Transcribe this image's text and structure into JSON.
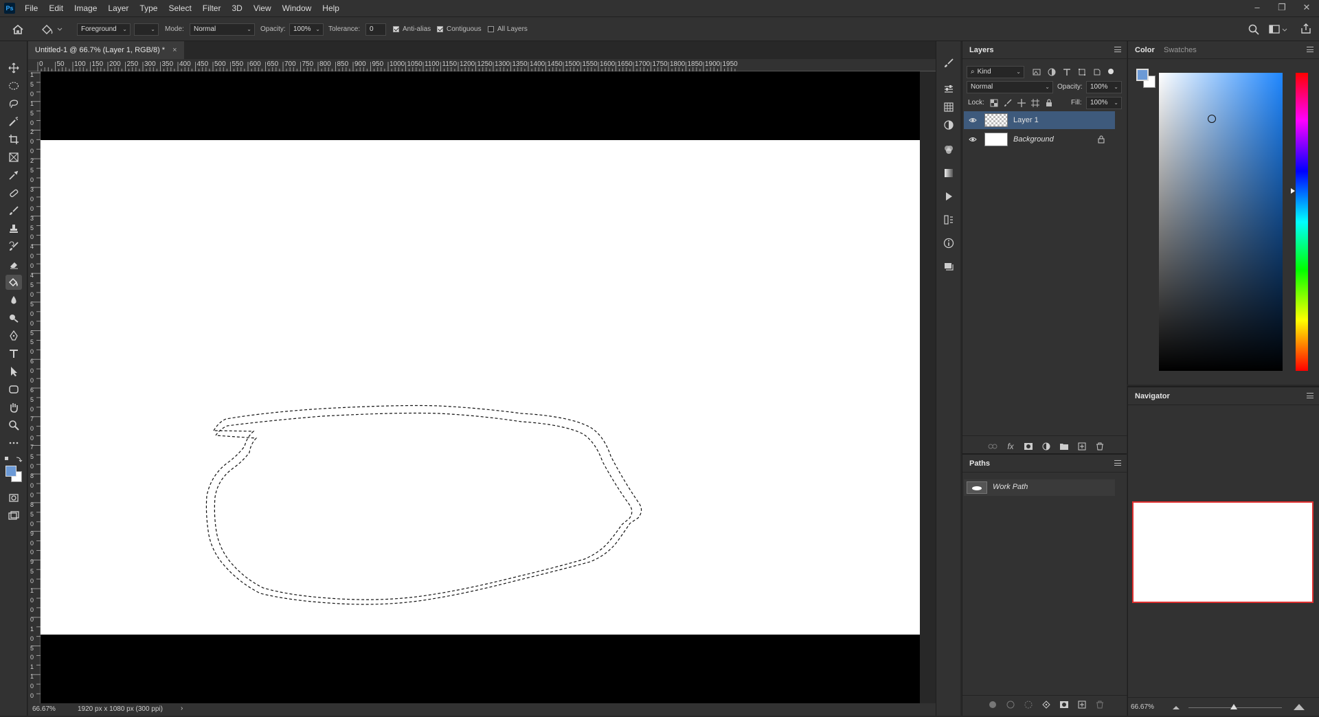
{
  "app": {
    "logo": "Ps"
  },
  "menu": [
    "File",
    "Edit",
    "Image",
    "Layer",
    "Type",
    "Select",
    "Filter",
    "3D",
    "View",
    "Window",
    "Help"
  ],
  "window_controls": {
    "minimize": "–",
    "restore": "❐",
    "close": "✕"
  },
  "options": {
    "fill_source": "Foreground",
    "mode_label": "Mode:",
    "mode_value": "Normal",
    "opacity_label": "Opacity:",
    "opacity_value": "100%",
    "tolerance_label": "Tolerance:",
    "tolerance_value": "0",
    "anti_alias": "Anti-alias",
    "contiguous": "Contiguous",
    "all_layers": "All Layers"
  },
  "document": {
    "tab_title": "Untitled-1 @ 66.7% (Layer 1, RGB/8) *",
    "close": "×",
    "zoom": "66.67%",
    "info": "1920 px x 1080 px (300 ppi)",
    "info_arrow": "›"
  },
  "ruler": {
    "h_labels": [
      "0",
      "50",
      "100",
      "150",
      "200",
      "250",
      "300",
      "350",
      "400",
      "450",
      "500",
      "550",
      "600",
      "650",
      "700",
      "750",
      "800",
      "850",
      "900",
      "950",
      "1000",
      "1050",
      "1100",
      "1150",
      "1200",
      "1250",
      "1300",
      "1350",
      "1400",
      "1450",
      "1500",
      "1550",
      "1600",
      "1650",
      "1700",
      "1750",
      "1800",
      "1850",
      "1900",
      "1950"
    ],
    "v_labels": [
      "1",
      "5",
      "0",
      "1",
      "5",
      "0",
      "2",
      "0",
      "0",
      "2",
      "5",
      "0",
      "3",
      "0",
      "0",
      "3",
      "5",
      "0",
      "4",
      "0",
      "0",
      "4",
      "5",
      "0",
      "5",
      "0",
      "0",
      "5",
      "5",
      "0",
      "6",
      "0",
      "0",
      "6",
      "5",
      "0",
      "7",
      "0",
      "0",
      "7",
      "5",
      "0",
      "8",
      "0",
      "0",
      "8",
      "5",
      "0",
      "9",
      "0",
      "0",
      "9",
      "5",
      "0",
      "1",
      "0",
      "0",
      "0",
      "1",
      "0",
      "5",
      "0",
      "1",
      "1",
      "0",
      "0"
    ]
  },
  "layers_panel": {
    "tab": "Layers",
    "filter": "Kind",
    "blend_mode": "Normal",
    "opacity_label": "Opacity:",
    "opacity_value": "100%",
    "lock_label": "Lock:",
    "fill_label": "Fill:",
    "fill_value": "100%",
    "layers": [
      {
        "name": "Layer 1",
        "selected": true
      },
      {
        "name": "Background",
        "selected": false
      }
    ]
  },
  "paths_panel": {
    "tab": "Paths",
    "items": [
      "Work Path"
    ]
  },
  "color_panel": {
    "tabs": [
      "Color",
      "Swatches"
    ],
    "foreground": "#6c9ad6",
    "background": "#ffffff",
    "hue_color": "#1f87ff"
  },
  "navigator_panel": {
    "tab": "Navigator",
    "zoom": "66.67%",
    "view_box_color": "#e03030"
  },
  "colors": {
    "ui_dark": "#323232",
    "selection_blue": "#3e5a7c"
  }
}
